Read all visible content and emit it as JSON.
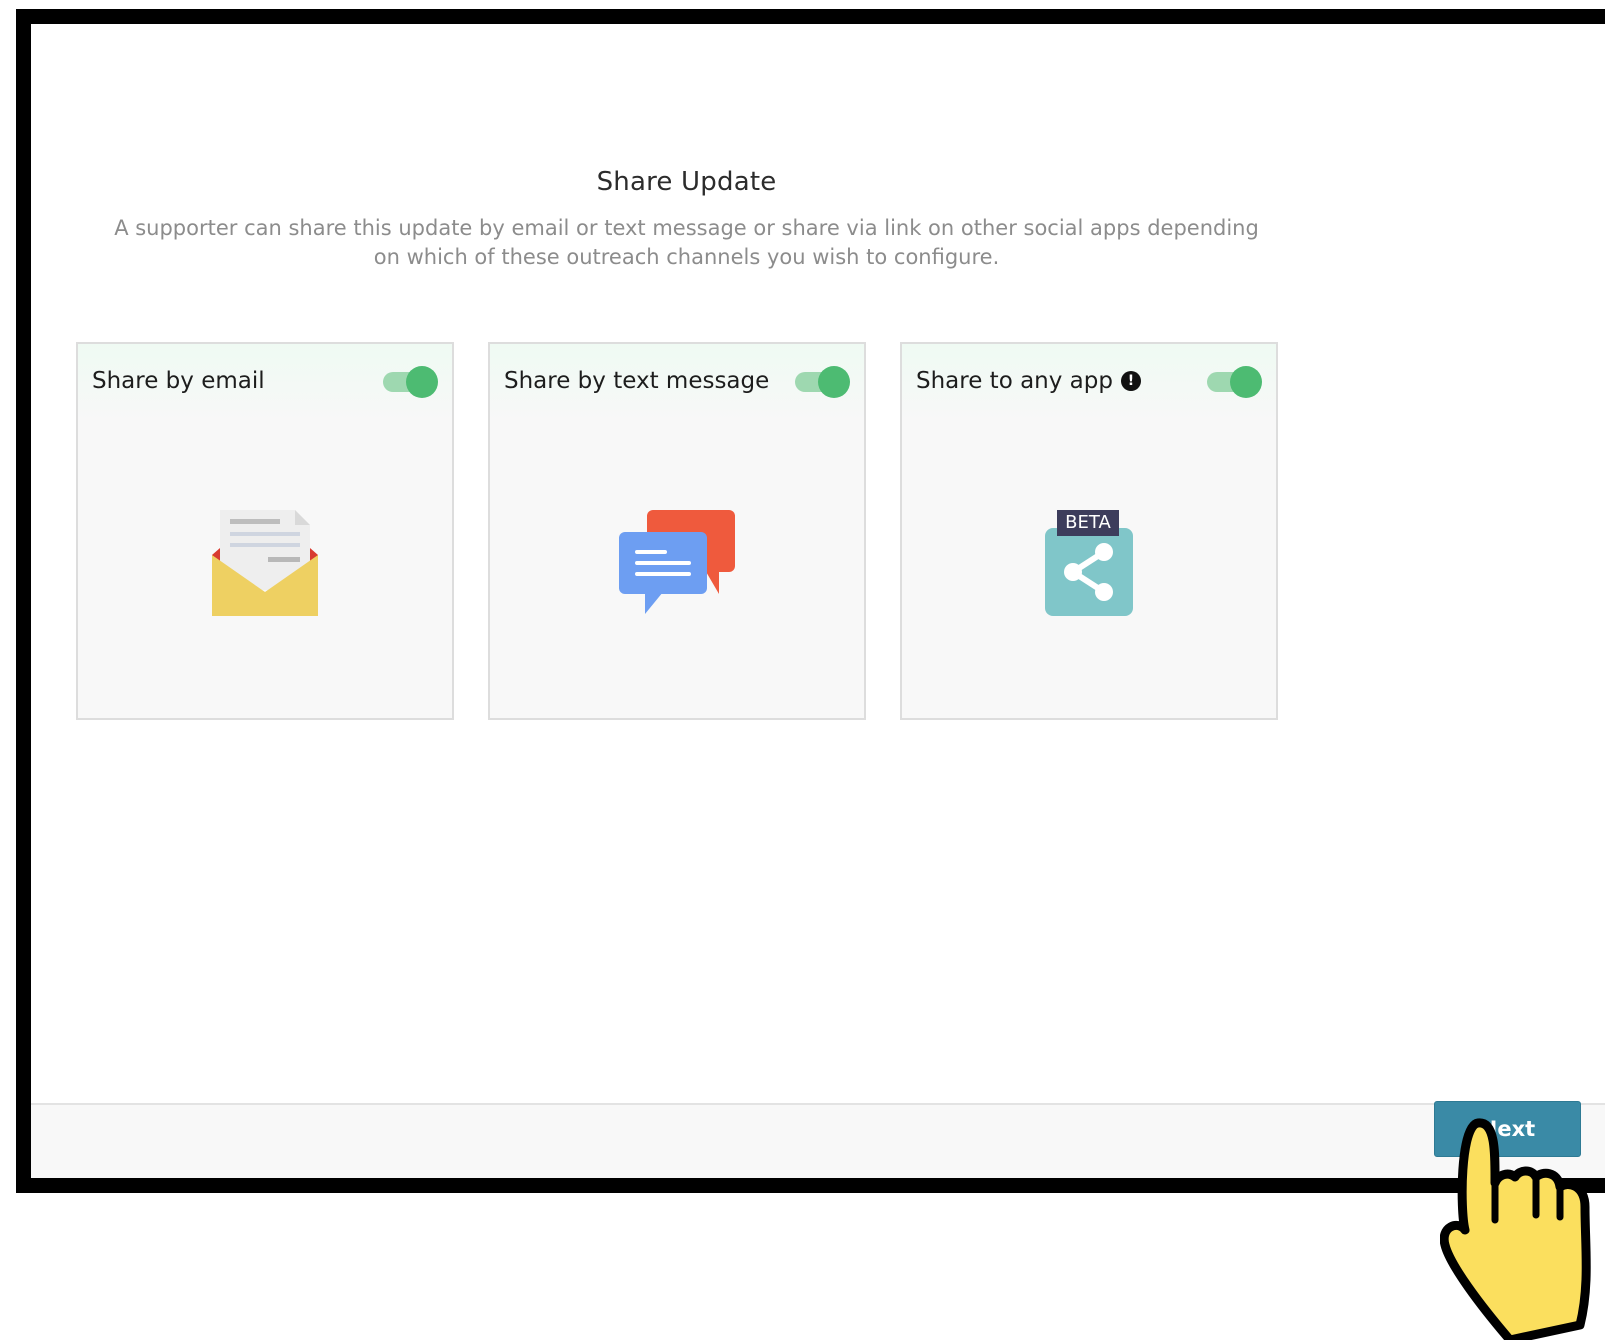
{
  "dialog": {
    "title": "Share Update",
    "description": "A supporter can share this update by email or text message or share via link on other social apps depending on which of these outreach channels you wish to configure."
  },
  "cards": [
    {
      "label": "Share by email",
      "enabled": true,
      "icon": "open-envelope-icon"
    },
    {
      "label": "Share by text message",
      "enabled": true,
      "icon": "chat-bubbles-icon"
    },
    {
      "label": "Share to any app",
      "enabled": true,
      "icon": "share-icon",
      "badge": "BETA",
      "info_icon": "info-icon"
    }
  ],
  "footer": {
    "next_label": "Next"
  },
  "colors": {
    "toggle_on": "#4dbb72",
    "primary_button": "#3a8aa6",
    "envelope": "#eed062",
    "chat_front": "#6d9ef2",
    "chat_back": "#ef5a3d",
    "share_tile": "#80c6c9"
  },
  "cursor": "pointing-hand-cursor"
}
